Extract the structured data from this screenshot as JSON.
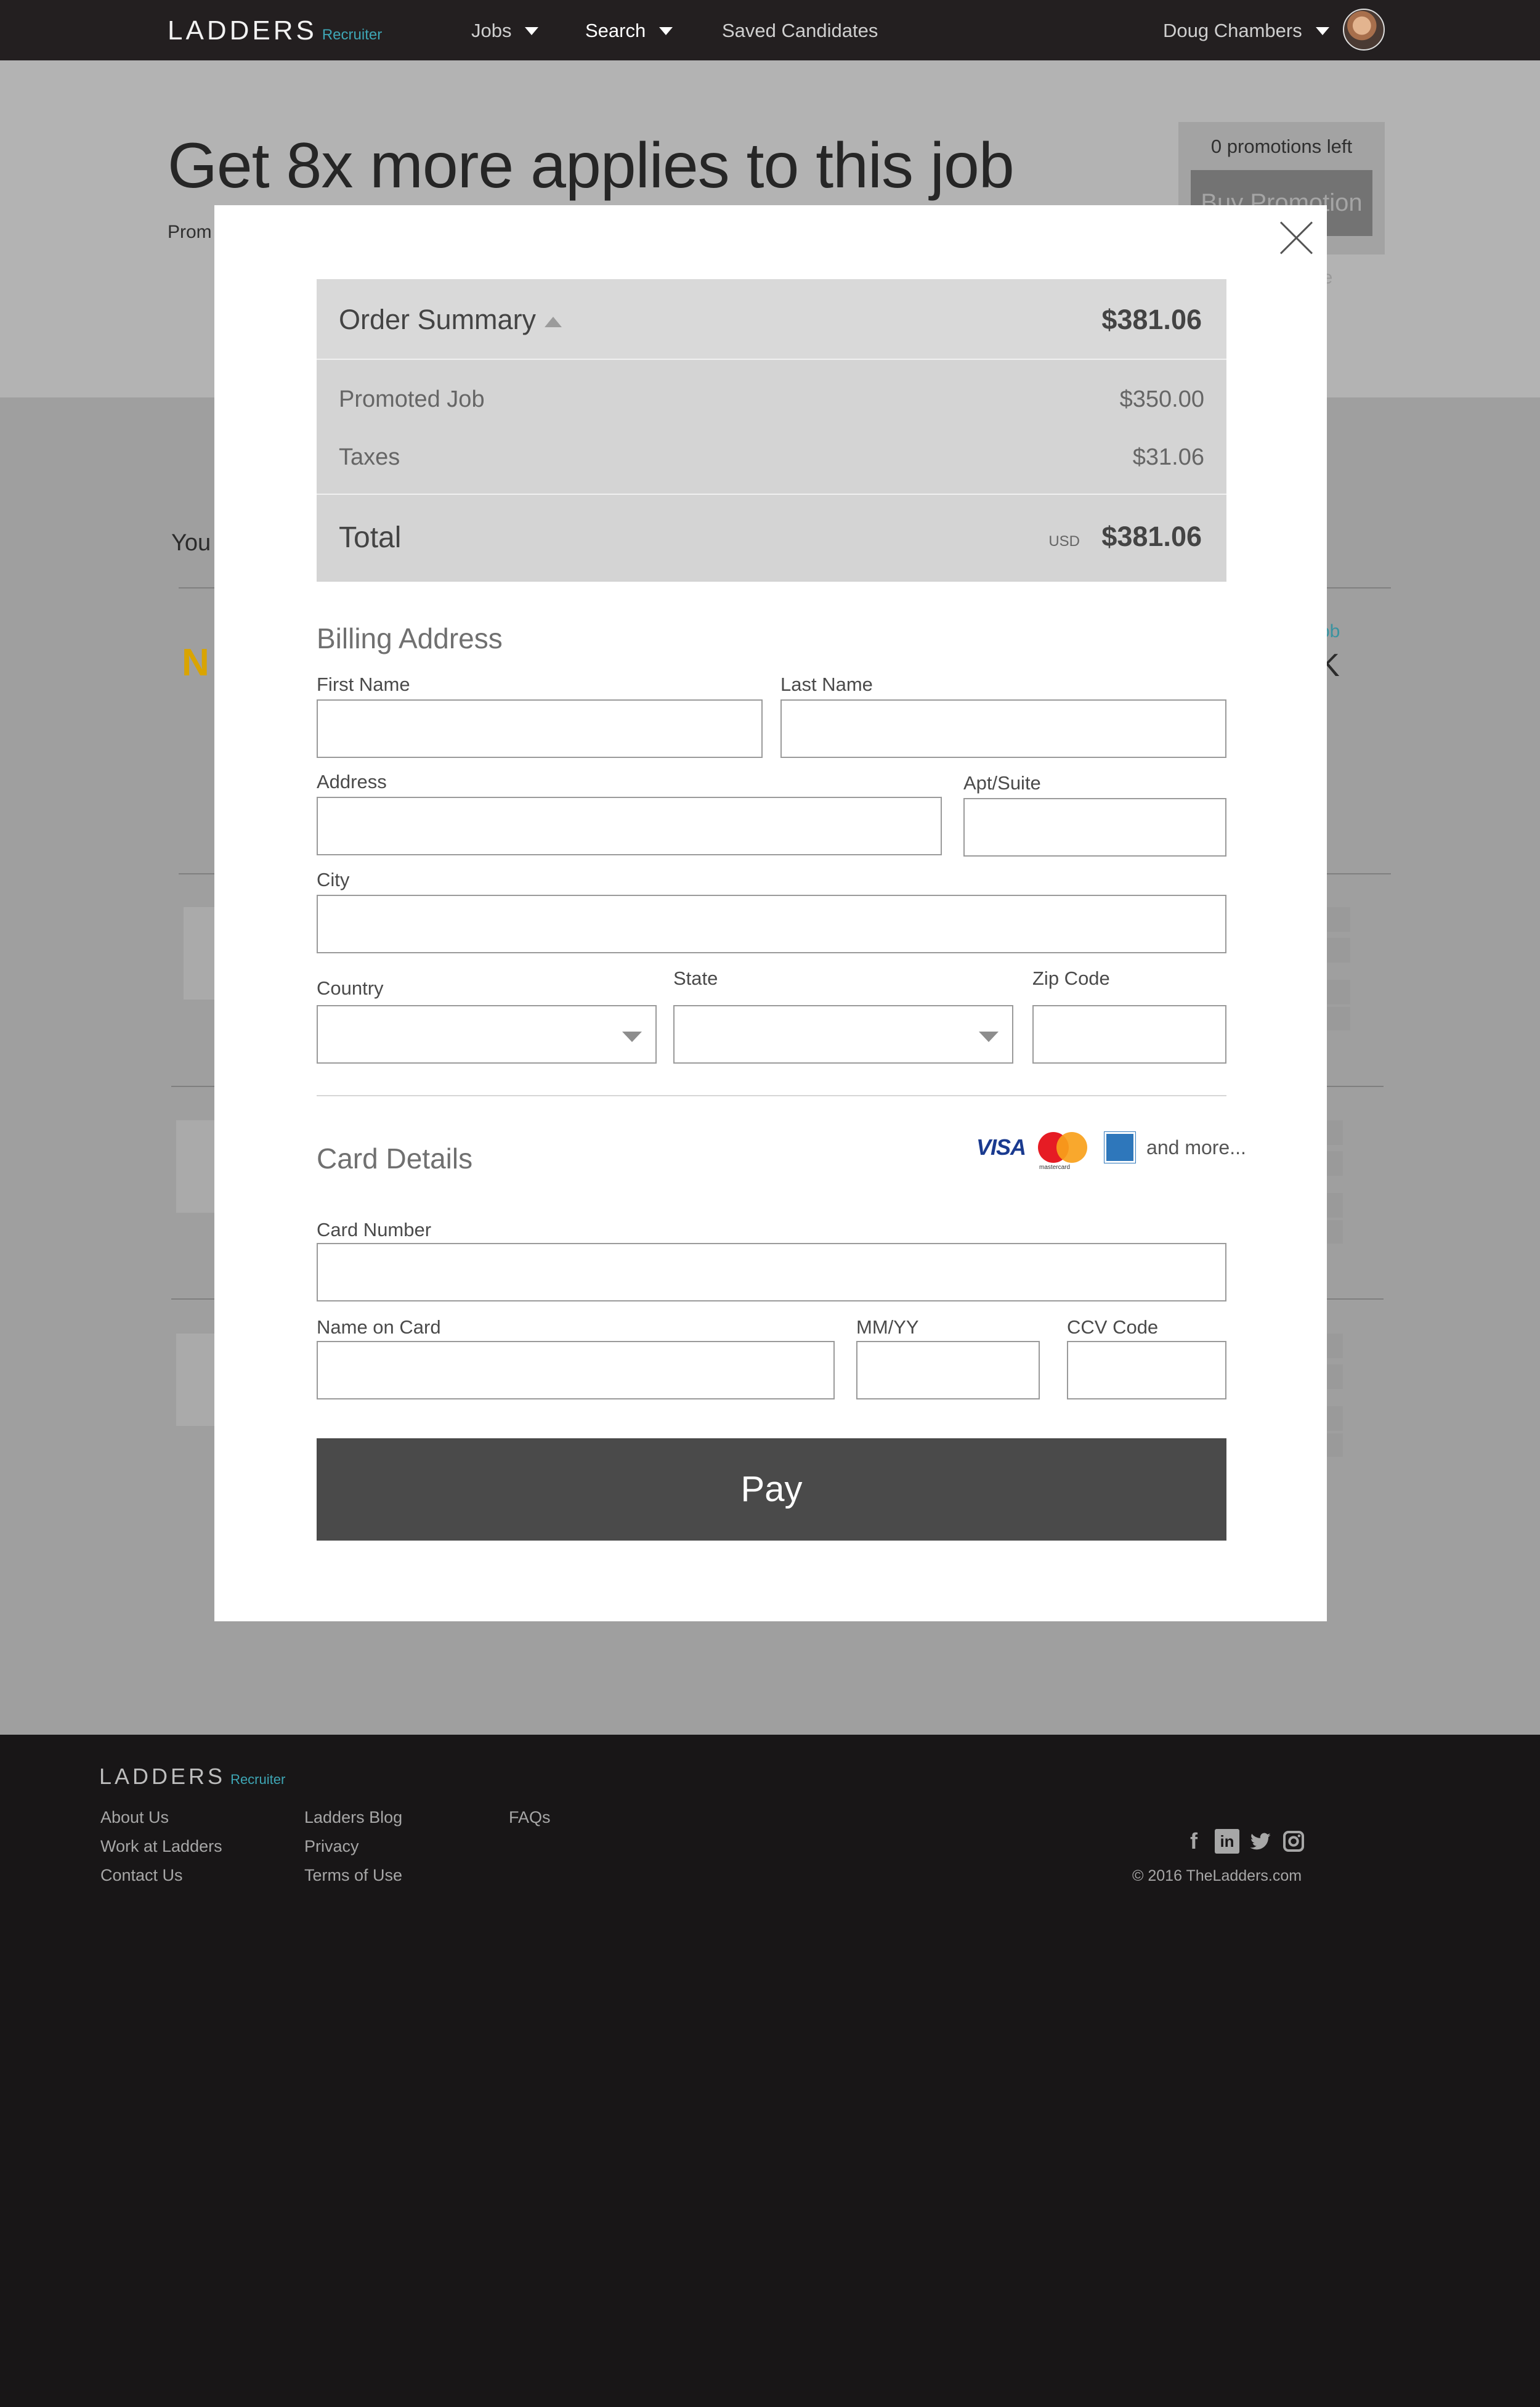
{
  "nav": {
    "logo_word": "LADDERS",
    "logo_sub": "Recruiter",
    "items": [
      {
        "label": "Jobs"
      },
      {
        "label": "Search"
      },
      {
        "label": "Saved Candidates"
      }
    ],
    "user_name": "Doug Chambers"
  },
  "background_page": {
    "hero_title": "Get 8x more applies to this job",
    "hero_sub": "Prom",
    "promotions_left": "0 promotions left",
    "buy_button": "Buy Promotion",
    "see_link": "ee",
    "you_label": "You",
    "company_logo": "N",
    "side_link": "ob",
    "side_value": "K"
  },
  "modal": {
    "order_summary": {
      "title": "Order Summary",
      "header_amount": "$381.06",
      "items": [
        {
          "label": "Promoted Job",
          "value": "$350.00"
        },
        {
          "label": "Taxes",
          "value": "$31.06"
        }
      ],
      "total_label": "Total",
      "currency": "USD",
      "total_amount": "$381.06"
    },
    "billing": {
      "title": "Billing Address",
      "first_name_label": "First Name",
      "last_name_label": "Last Name",
      "address_label": "Address",
      "apt_label": "Apt/Suite",
      "city_label": "City",
      "country_label": "Country",
      "state_label": "State",
      "zip_label": "Zip Code",
      "first_name_value": "",
      "last_name_value": "",
      "address_value": "",
      "apt_value": "",
      "city_value": "",
      "zip_value": ""
    },
    "card": {
      "title": "Card Details",
      "brands": [
        "VISA",
        "mastercard",
        "american-express"
      ],
      "visa_text": "VISA",
      "mastercard_text": "mastercard",
      "and_more": "and more...",
      "card_number_label": "Card Number",
      "name_on_card_label": "Name on Card",
      "expiry_label": "MM/YY",
      "ccv_label": "CCV Code",
      "card_number_value": "",
      "name_on_card_value": "",
      "expiry_value": "",
      "ccv_value": ""
    },
    "pay_button": "Pay"
  },
  "footer": {
    "logo_word": "LADDERS",
    "logo_sub": "Recruiter",
    "col1": [
      "About Us",
      "Work at Ladders",
      "Contact Us"
    ],
    "col2": [
      "Ladders Blog",
      "Privacy",
      "Terms of Use"
    ],
    "col3": [
      "FAQs"
    ],
    "social": [
      "facebook-icon",
      "linkedin-icon",
      "twitter-icon",
      "instagram-icon"
    ],
    "copyright": "© 2016 TheLadders.com"
  },
  "colors": {
    "accent": "#3ea6b5",
    "nav_bg": "#231f20",
    "pay_button": "#4a4a4a",
    "overlay_page": "#9f9f9f"
  }
}
